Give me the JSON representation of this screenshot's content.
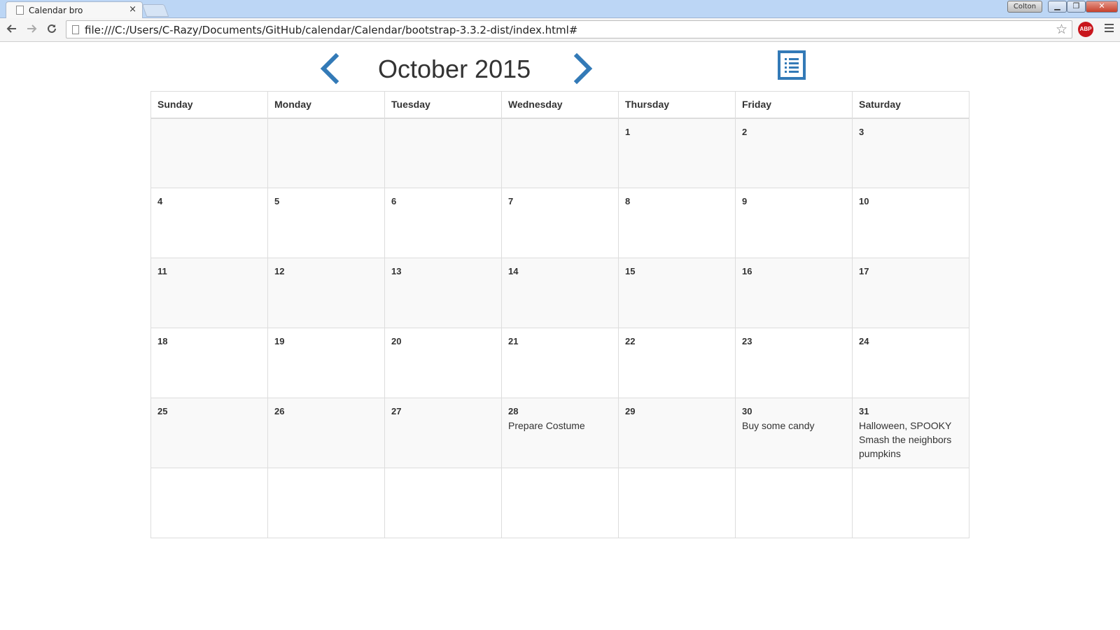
{
  "browser": {
    "tab_title": "Calendar bro",
    "tab_close": "×",
    "user_name": "Colton",
    "min_label": "▁",
    "max_label": "❐",
    "close_label": "✕",
    "back_icon": "arrow-left-icon",
    "forward_icon": "arrow-right-icon",
    "reload_icon": "reload-icon",
    "url": "file:///C:/Users/C-Razy/Documents/GitHub/calendar/Calendar/bootstrap-3.3.2-dist/index.html#",
    "star_glyph": "☆",
    "abp_label": "ABP"
  },
  "calendar": {
    "month_title": "October 2015",
    "accent_color": "#337ab7",
    "weekdays": [
      "Sunday",
      "Monday",
      "Tuesday",
      "Wednesday",
      "Thursday",
      "Friday",
      "Saturday"
    ],
    "weeks": [
      [
        "",
        "",
        "",
        "",
        "1",
        "2",
        "3"
      ],
      [
        "4",
        "5",
        "6",
        "7",
        "8",
        "9",
        "10"
      ],
      [
        "11",
        "12",
        "13",
        "14",
        "15",
        "16",
        "17"
      ],
      [
        "18",
        "19",
        "20",
        "21",
        "22",
        "23",
        "24"
      ],
      [
        "25",
        "26",
        "27",
        "28",
        "29",
        "30",
        "31"
      ],
      [
        "",
        "",
        "",
        "",
        "",
        "",
        ""
      ]
    ],
    "events": {
      "28": [
        "Prepare Costume"
      ],
      "30": [
        "Buy some candy"
      ],
      "31": [
        "Halloween, SPOOKY",
        "Smash the neighbors pumpkins"
      ]
    }
  }
}
